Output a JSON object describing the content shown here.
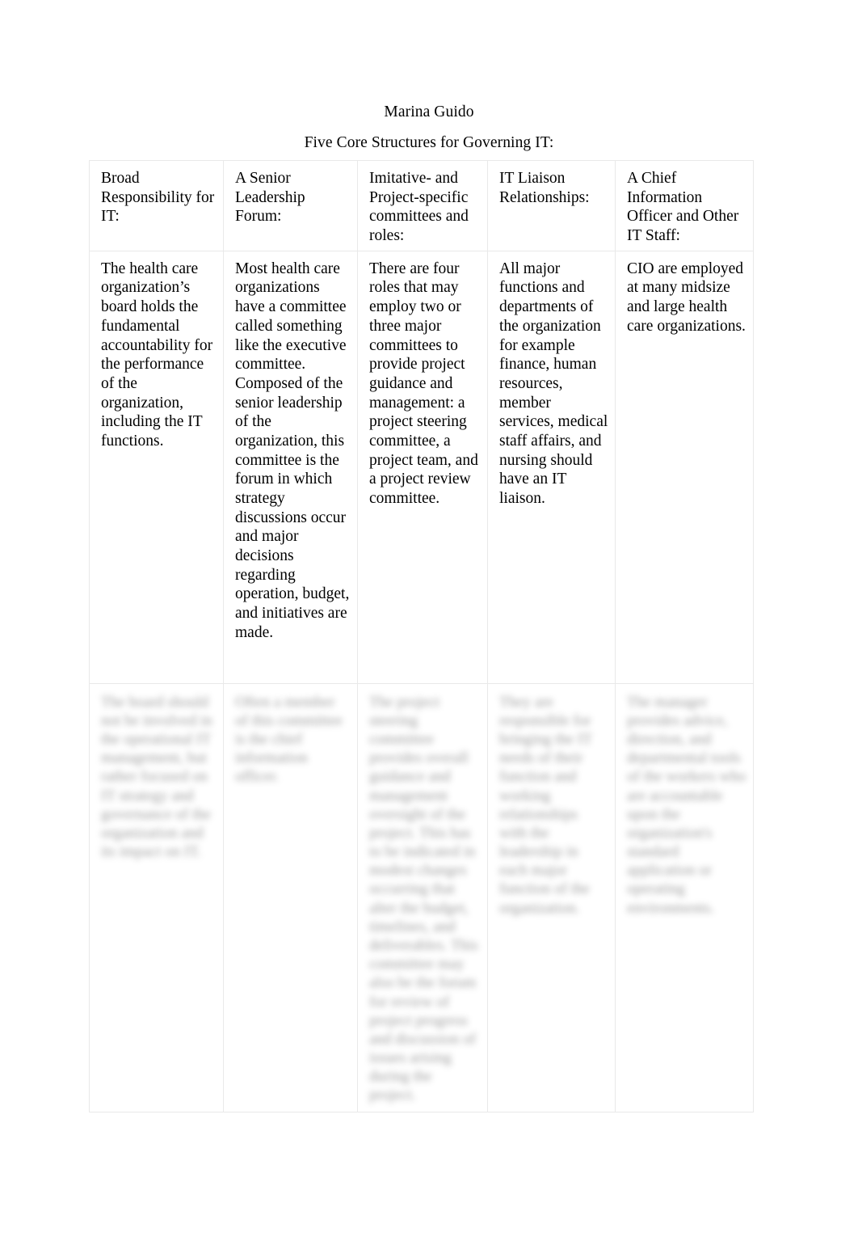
{
  "document": {
    "author": "Marina Guido",
    "title": "Five Core Structures for Governing IT:"
  },
  "table": {
    "headers": [
      "Broad Responsibility for IT:",
      "A Senior Leadership Forum:",
      "Imitative- and Project-specific committees and roles:",
      "IT Liaison Relationships:",
      "A Chief Information Officer and Other IT Staff:"
    ],
    "rows": [
      {
        "cells": [
          "The health care organization’s board holds the fundamental accountability for the performance of the organization, including the IT functions.",
          "Most health care organizations have a committee called something like the executive committee. Composed of the senior leadership of the organization, this committee is the forum in which strategy discussions occur and major decisions regarding operation, budget, and initiatives are made.",
          "There are four roles that may employ two or three major committees to provide project guidance and management: a project steering committee, a project team, and a project review committee.",
          "All major functions and departments of the organization for example finance, human resources, member services, medical staff affairs, and nursing should have an IT liaison.",
          "CIO are employed at many midsize and large health care organizations."
        ]
      },
      {
        "blurred": true,
        "cells": [
          "The board should not be involved in the operational IT management, but rather focused on IT strategy and governance of the organization and its impact on IT.",
          "Often a member of this committee is the chief information officer.",
          "The project steering committee provides overall guidance and management oversight of the project. This has to be indicated in modest changes occurring that alter the budget, timelines, and deliverables. This committee may also be the forum for review of project progress and discussion of issues arising during the project.",
          "They are responsible for bringing the IT needs of their function and working relationships with the leadership in each major function of the organization.",
          "The manager provides advice, direction, and departmental tools of the workers who are accountable upon the organization's standard application or operating environments."
        ]
      }
    ]
  }
}
